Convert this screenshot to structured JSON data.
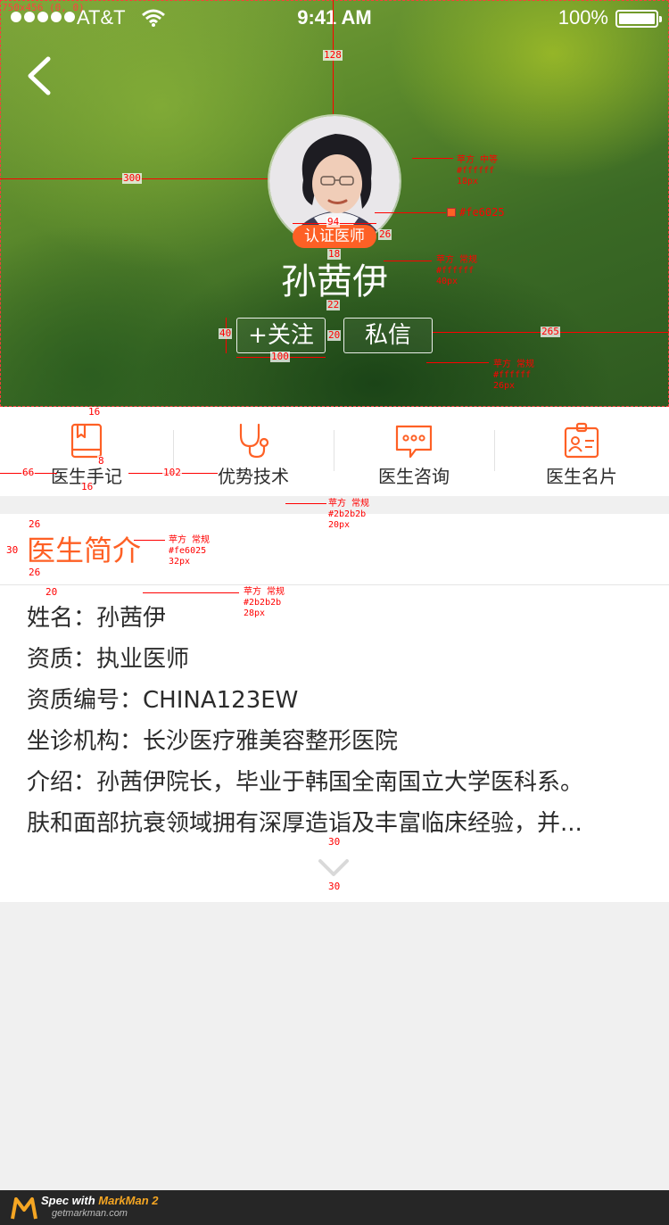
{
  "status_bar": {
    "carrier": "AT&T",
    "time": "9:41 AM",
    "battery": "100%"
  },
  "profile": {
    "badge": "认证医师",
    "name": "孙茜伊",
    "follow_label": "+关注",
    "message_label": "私信"
  },
  "features": [
    {
      "label": "医生手记",
      "icon": "notebook-icon"
    },
    {
      "label": "优势技术",
      "icon": "stethoscope-icon"
    },
    {
      "label": "医生咨询",
      "icon": "chat-bubble-icon"
    },
    {
      "label": "医生名片",
      "icon": "id-badge-icon"
    }
  ],
  "intro": {
    "title": "医生简介",
    "lines": [
      "姓名：孙茜伊",
      "资质：执业医师",
      "资质编号：CHINA123EW",
      "坐诊机构：长沙医疗雅美容整形医院",
      "介绍：孙茜伊院长，毕业于韩国全南国立大学医科系。",
      "肤和面部抗衰领域拥有深厚造诣及丰富临床经验，并..."
    ]
  },
  "colors": {
    "accent": "#fe6025",
    "text": "#2b2b2b",
    "white": "#ffffff"
  },
  "annotations": {
    "frame": "750x456 (0, 0)",
    "d128": "128",
    "d300": "300",
    "d94": "94",
    "d26": "26",
    "d18": "18",
    "d22": "22",
    "d40": "40",
    "d20": "20",
    "d100": "100",
    "d265": "265",
    "d16a": "16",
    "d8": "8",
    "d16b": "16",
    "d66": "66",
    "d102": "102",
    "d26b": "26",
    "d30": "30",
    "d26c": "26",
    "d20b": "20",
    "d30b": "30",
    "d30c": "30",
    "spec_badge": "苹方 中等\n#ffffff\n18px",
    "spec_color": "#fe6025",
    "spec_name": "苹方 常规\n#ffffff\n40px",
    "spec_btn": "苹方 常规\n#ffffff\n26px",
    "spec_feat": "苹方 常规\n#2b2b2b\n20px",
    "spec_title": "苹方 常规\n#fe6025\n32px",
    "spec_body": "苹方 常规\n#2b2b2b\n28px"
  },
  "markman": {
    "prefix": "Spec with ",
    "brand": "MarkMan 2",
    "url": "getmarkman.com"
  }
}
